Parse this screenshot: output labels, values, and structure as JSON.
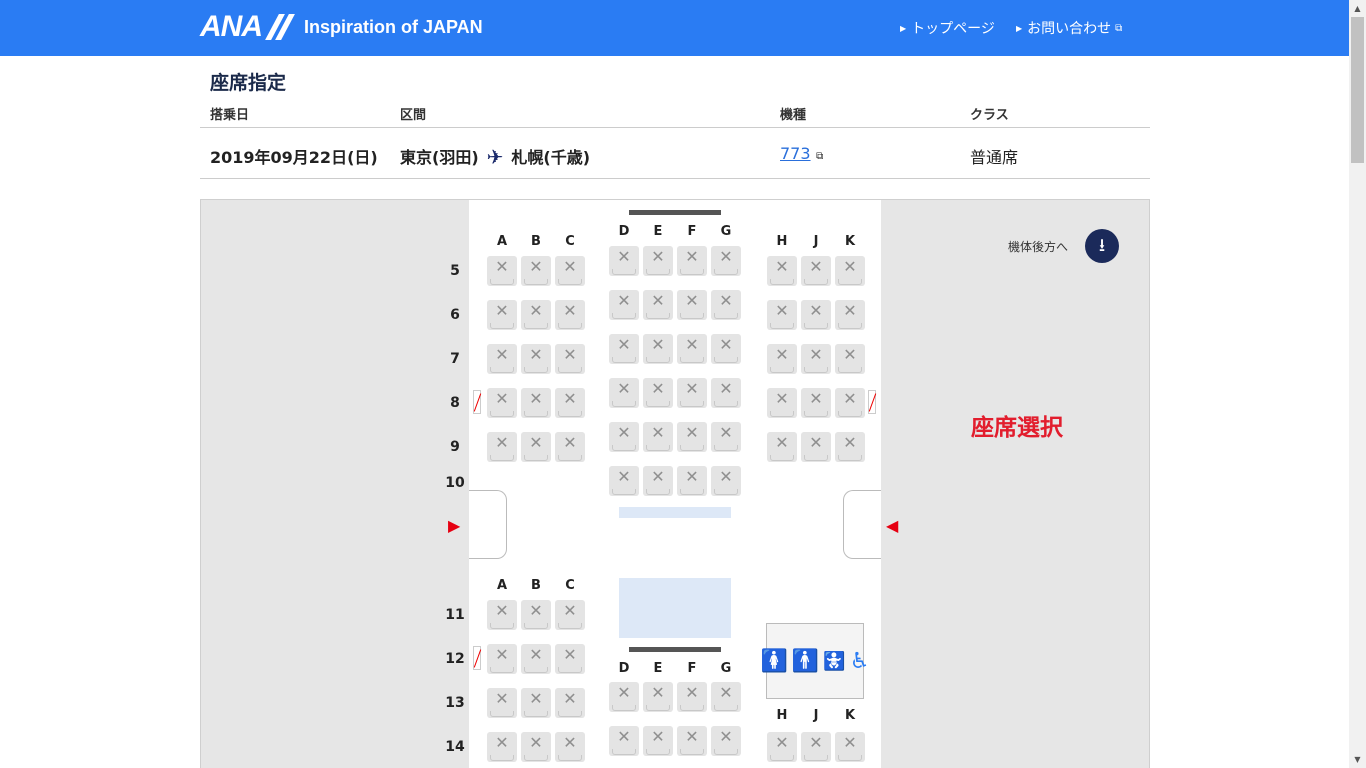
{
  "header": {
    "logo": "ANA",
    "tagline": "Inspiration of JAPAN",
    "nav": [
      "トップページ",
      "お問い合わせ"
    ]
  },
  "page": {
    "title": "座席指定"
  },
  "flight": {
    "headers": {
      "date": "搭乗日",
      "route": "区間",
      "aircraft": "機種",
      "class": "クラス"
    },
    "date": "2019年09月22日(日)",
    "origin": "東京(羽田)",
    "destination": "札幌(千歳)",
    "aircraft": "773",
    "class": "普通席"
  },
  "seatmap": {
    "rear_label": "機体後方へ",
    "select_label": "座席選択",
    "upper_columns": {
      "left": [
        "A",
        "B",
        "C"
      ],
      "center": [
        "D",
        "E",
        "F",
        "G"
      ],
      "right": [
        "H",
        "J",
        "K"
      ]
    },
    "lower_columns": {
      "left": [
        "A",
        "B",
        "C"
      ],
      "center": [
        "D",
        "E",
        "F",
        "G"
      ],
      "right": [
        "H",
        "J",
        "K"
      ]
    },
    "rows_upper": [
      "5",
      "6",
      "7",
      "8",
      "9",
      "10"
    ],
    "rows_lower": [
      "11",
      "12",
      "13",
      "14"
    ],
    "seat_status": "occupied",
    "colors": {
      "header": "#2a7cf3",
      "accent": "#e21d2d",
      "navy": "#1b2a5a"
    },
    "icons": [
      "exit-arrow-icon",
      "lavatory-female-icon",
      "lavatory-male-icon",
      "baby-care-icon",
      "wheelchair-icon",
      "window-icon"
    ]
  }
}
